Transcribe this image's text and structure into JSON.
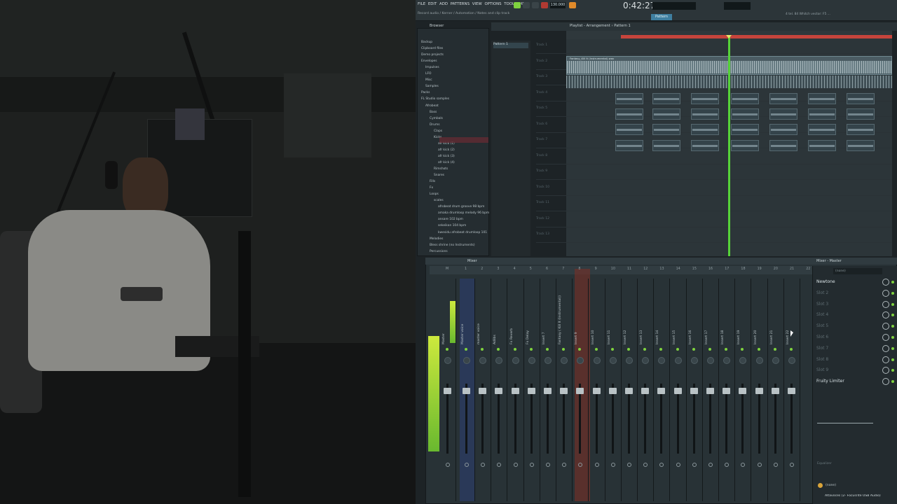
{
  "app": {
    "name": "FL Studio"
  },
  "menubar": {
    "items": [
      "FILE",
      "EDIT",
      "ADD",
      "PATTERNS",
      "VIEW",
      "OPTIONS",
      "TOOLS",
      "HELP"
    ]
  },
  "transport": {
    "time": "0:42:27",
    "bpm": "130.000",
    "pattern": "Pattern 1",
    "mode": "Pattern",
    "hint_line": "4 tel. 84 Whitch vector: F5 ..."
  },
  "hint": {
    "text": "Record audio / Kerner / Automation / Notes and clip track"
  },
  "browser": {
    "header": "Browser",
    "items": [
      "Backup",
      "Clipboard files",
      "Demo projects",
      "Envelopes",
      "Impulses",
      "LFO",
      "Misc",
      "Samples",
      "Packs",
      "FL Studio samples",
      "Afrobeat",
      "Bass",
      "Cymbals",
      "Drums",
      "Claps",
      "Kicks",
      "afr kick (1)",
      "afr kick (2)",
      "afr kick (3)",
      "afr kick (4)",
      "Rimshots",
      "Snares",
      "Fills",
      "Fx",
      "Loops",
      "scales",
      "afrobeat drum groove 98 bpm",
      "amaka drumloop melody 96 bpm",
      "ansare 102 bpm",
      "sekeikan 104 bpm",
      "kwesidu afrobeat drumloop 101",
      "Melodies",
      "Bless shrine (no Instruments)",
      "Percussions"
    ]
  },
  "playlist": {
    "title": "Playlist - Arrangement › Pattern 1",
    "pattern_item": "Pattern 1",
    "tracks": [
      "Track 1",
      "Track 2",
      "Track 3",
      "Track 4",
      "Track 5",
      "Track 6",
      "Track 7",
      "Track 8",
      "Track 9",
      "Track 10",
      "Track 11",
      "Track 12",
      "Track 13"
    ],
    "audio_clip": "Fantasy_Kill It (Instrumental).wav"
  },
  "mixer": {
    "title": "Mixer",
    "master_label": "Master",
    "channels": [
      "Master",
      "Master voice",
      "master voice",
      "Adlibs",
      "Fx Reverb",
      "Fx Delay",
      "Insert 7",
      "Fantasy ( Kill It (Instrumental))",
      "Insert 9",
      "Insert 10",
      "Insert 11",
      "Insert 12",
      "Insert 13",
      "Insert 14",
      "Insert 15",
      "Insert 16",
      "Insert 17",
      "Insert 18",
      "Insert 19",
      "Insert 20",
      "Insert 21",
      "Insert 22"
    ],
    "numbers": [
      "M",
      "1",
      "2",
      "3",
      "4",
      "5",
      "6",
      "7",
      "8",
      "9",
      "10",
      "11",
      "12",
      "13",
      "14",
      "15",
      "16",
      "17",
      "18",
      "19",
      "20",
      "21",
      "22"
    ]
  },
  "fx_chain": {
    "header": "Mixer - Master",
    "preset": "(none)",
    "slots": [
      "Newtone",
      "Slot 2",
      "Slot 3",
      "Slot 4",
      "Slot 5",
      "Slot 6",
      "Slot 7",
      "Slot 8",
      "Slot 9",
      "Fruity Limiter"
    ],
    "eq_label": "Equalizer",
    "input_label": "(none)",
    "output_label": "Altavoces (2- Focusrite USB Audio)"
  },
  "colors": {
    "accent": "#7fd23f",
    "playhead": "#56d339",
    "marker": "#e0463c",
    "highlight_blue": "#2b3f7a",
    "highlight_red": "#7a2f27"
  }
}
